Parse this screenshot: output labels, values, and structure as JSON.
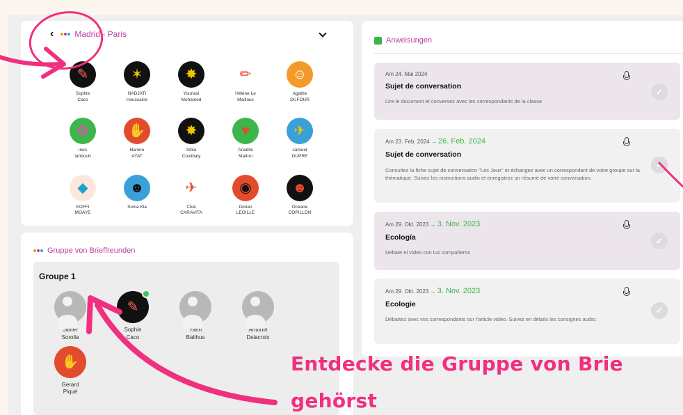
{
  "group_card": {
    "title": "Madrid - Paris",
    "members": [
      {
        "first": "Sophie",
        "last": "Caco",
        "bg": "#111111",
        "glyph": "✎",
        "fg": "#ff6a4d"
      },
      {
        "first": "NADJATI",
        "last": "Houssaine",
        "bg": "#111111",
        "glyph": "✶",
        "fg": "#f5c400"
      },
      {
        "first": "Younasi",
        "last": "Mohamed",
        "bg": "#111111",
        "glyph": "✸",
        "fg": "#f5c400"
      },
      {
        "first": "Hélène Le",
        "last": "Mailloux",
        "bg": "#ffffff",
        "glyph": "✏",
        "fg": "#e24b2c"
      },
      {
        "first": "Agathe",
        "last": "DUFOUR",
        "bg": "#f29b2a",
        "glyph": "☺",
        "fg": "#ffffff"
      },
      {
        "first": "ines",
        "last": "lahboub",
        "bg": "#3cb54a",
        "glyph": "✿",
        "fg": "#e64fb5"
      },
      {
        "first": "Hanine",
        "last": "AYAT",
        "bg": "#e24b2c",
        "glyph": "✋",
        "fg": "#3aa0d8"
      },
      {
        "first": "Sibla",
        "last": "Coulibaly",
        "bg": "#111111",
        "glyph": "✸",
        "fg": "#f5c400"
      },
      {
        "first": "Anaëlle",
        "last": "Matton",
        "bg": "#3cb54a",
        "glyph": "♥",
        "fg": "#e24b2c"
      },
      {
        "first": "samuel",
        "last": "DUPRE",
        "bg": "#3aa0d8",
        "glyph": "✈",
        "fg": "#f5c400"
      },
      {
        "first": "KOFFI",
        "last": "MOAYE",
        "bg": "#fde7dd",
        "glyph": "◆",
        "fg": "#1ea2c8"
      },
      {
        "first": "Sonia Kla",
        "last": "",
        "bg": "#3aa0d8",
        "glyph": "☻",
        "fg": "#111111"
      },
      {
        "first": "Cloé",
        "last": "CARAVITA",
        "bg": "#ffffff",
        "glyph": "✈",
        "fg": "#e24b2c"
      },
      {
        "first": "Dorian",
        "last": "LEGILLE",
        "bg": "#e24b2c",
        "glyph": "◉",
        "fg": "#111111"
      },
      {
        "first": "Océane",
        "last": "COPILLON",
        "bg": "#111111",
        "glyph": "☻",
        "fg": "#e24b2c"
      }
    ]
  },
  "pen_card": {
    "title": "Gruppe von Brieffreunden",
    "group_name": "Groupe 1",
    "members": [
      {
        "first": "Javier",
        "last": "Sorolla",
        "type": "gray",
        "bg": "#b8b8b8",
        "glyph": ""
      },
      {
        "first": "Sophie",
        "last": "Caco",
        "type": "img",
        "bg": "#111111",
        "glyph": "✎",
        "fg": "#ff6a4d",
        "online": true
      },
      {
        "first": "Yann",
        "last": "Balthus",
        "type": "gray",
        "bg": "#b8b8b8",
        "glyph": ""
      },
      {
        "first": "Antonin",
        "last": "Delacroix",
        "type": "gray",
        "bg": "#b8b8b8",
        "glyph": ""
      },
      {
        "first": "Gerard",
        "last": "Piqué",
        "type": "img",
        "bg": "#e24b2c",
        "glyph": "✋",
        "fg": "#3aa0d8"
      }
    ]
  },
  "instructions": {
    "title": "Anweisungen",
    "tasks": [
      {
        "date_from": "Am 24. Mai 2024",
        "date_to": "",
        "title": "Sujet de conversation",
        "desc": "Lire le document et conversez avec les correspondants de la classe"
      },
      {
        "date_from": "Am 23. Feb. 2024",
        "date_to": "26. Feb. 2024",
        "title": "Sujet de conversation",
        "desc": "Consultez la fiche sujet de conversation \"Les Jeux\" et échangez avec un correspondant de votre groupe sur la thématique. Suivez les instructions audio et enregistrez un résumé de votre conversation."
      },
      {
        "date_from": "Am 29. Okt. 2023",
        "date_to": "3. Nov. 2023",
        "title": "Ecología",
        "desc": "Debate el vídeo con tus compañeros"
      },
      {
        "date_from": "Am 29. Okt. 2023",
        "date_to": "3. Nov. 2023",
        "title": "Ecologie",
        "desc": "Débattez avec vos correspondants sur l'article vidéo. Suivez en détails les consignes audio."
      }
    ]
  },
  "banner": {
    "line1": "Entdecke die Gruppe von Brie",
    "line2": "gehörst"
  },
  "colors": {
    "accent": "#c13fa0",
    "annotation": "#f0307f",
    "done": "#3cb54a"
  }
}
